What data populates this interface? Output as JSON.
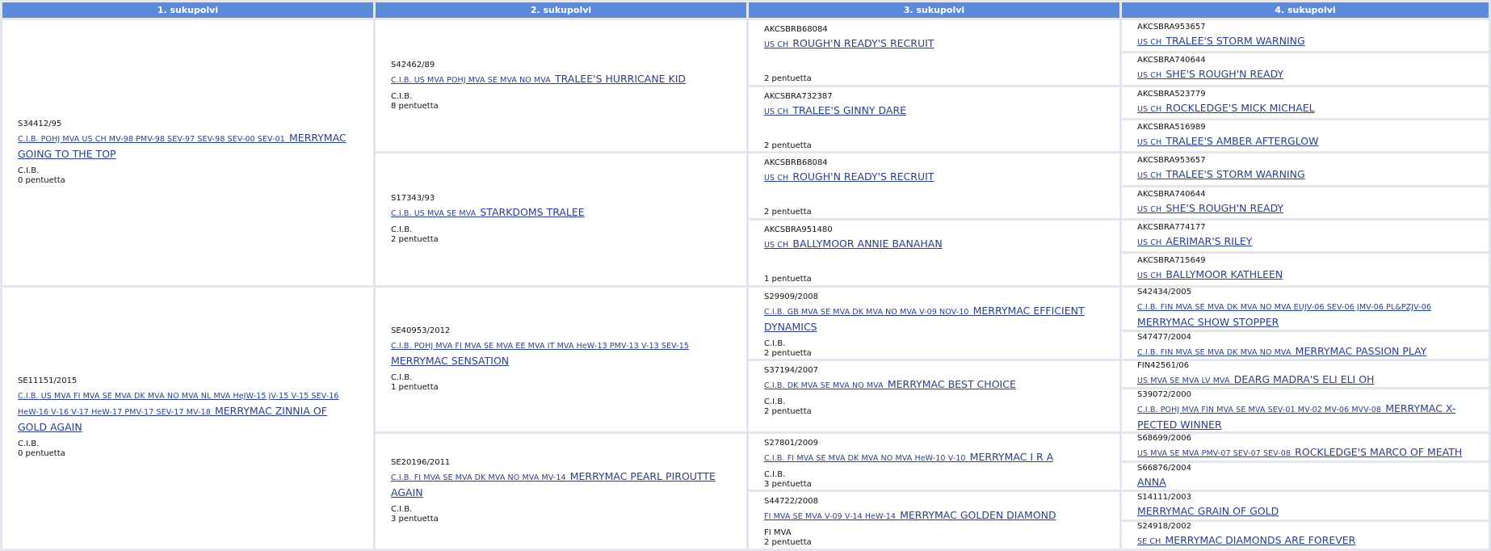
{
  "headers": [
    "1. sukupolvi",
    "2. sukupolvi",
    "3. sukupolvi",
    "4. sukupolvi"
  ],
  "gen1": [
    {
      "reg": "S34412/95",
      "titles": "C.I.B. POHJ MVA US CH MV-98 PMV-98 SEV-97 SEV-98 SEV-00 SEV-01",
      "name": "MERRYMAC GOING TO THE TOP",
      "l1": "C.I.B.",
      "l2": "0 pentuetta"
    },
    {
      "reg": "SE11151/2015",
      "titles": "C.I.B. US MVA FI MVA SE MVA DK MVA NO MVA NL MVA HeJW-15 JV-15 V-15 SEV-16 HeW-16 V-16 V-17 HeW-17 PMV-17 SEV-17 MV-18",
      "name": "MERRYMAC ZINNIA OF GOLD AGAIN",
      "l1": "C.I.B.",
      "l2": "0 pentuetta"
    }
  ],
  "gen2": [
    {
      "reg": "S42462/89",
      "titles": "C.I.B. US MVA POHJ MVA SE MVA NO MVA",
      "name": "TRALEE'S HURRICANE KID",
      "l1": "C.I.B.",
      "l2": "8 pentuetta"
    },
    {
      "reg": "S17343/93",
      "titles": "C.I.B. US MVA SE MVA",
      "name": "STARKDOMS TRALEE",
      "l1": "C.I.B.",
      "l2": "2 pentuetta"
    },
    {
      "reg": "SE40953/2012",
      "titles": "C.I.B. POHJ MVA FI MVA SE MVA EE MVA IT MVA HeW-13 PMV-13 V-13 SEV-15",
      "name": "MERRYMAC SENSATION",
      "l1": "C.I.B.",
      "l2": "1 pentuetta"
    },
    {
      "reg": "SE20196/2011",
      "titles": "C.I.B. FI MVA SE MVA DK MVA NO MVA MV-14",
      "name": "MERRYMAC PEARL PIROUTTE AGAIN",
      "l1": "C.I.B.",
      "l2": "3 pentuetta"
    }
  ],
  "gen3": [
    {
      "reg": "AKCSBRB68084",
      "titles": "US CH",
      "name": "ROUGH'N READY'S RECRUIT",
      "l1": "",
      "l2": "2 pentuetta"
    },
    {
      "reg": "AKCSBRA732387",
      "titles": "US CH",
      "name": "TRALEE'S GINNY DARE",
      "l1": "",
      "l2": "2 pentuetta"
    },
    {
      "reg": "AKCSBRB68084",
      "titles": "US CH",
      "name": "ROUGH'N READY'S RECRUIT",
      "l1": "",
      "l2": "2 pentuetta"
    },
    {
      "reg": "AKCSBRA951480",
      "titles": "US CH",
      "name": "BALLYMOOR ANNIE BANAHAN",
      "l1": "",
      "l2": "1 pentuetta"
    },
    {
      "reg": "S29909/2008",
      "titles": "C.I.B. GB MVA SE MVA DK MVA NO MVA V-09 NOV-10",
      "name": "MERRYMAC EFFICIENT DYNAMICS",
      "l1": "C.I.B.",
      "l2": "2 pentuetta"
    },
    {
      "reg": "S37194/2007",
      "titles": "C.I.B. DK MVA SE MVA NO MVA",
      "name": "MERRYMAC BEST CHOICE",
      "l1": "C.I.B.",
      "l2": "2 pentuetta"
    },
    {
      "reg": "S27801/2009",
      "titles": "C.I.B. FI MVA SE MVA DK MVA NO MVA HeW-10 V-10",
      "name": "MERRYMAC I R A",
      "l1": "C.I.B.",
      "l2": "3 pentuetta"
    },
    {
      "reg": "S44722/2008",
      "titles": "FI MVA SE MVA V-09 V-14 HeW-14",
      "name": "MERRYMAC GOLDEN DIAMOND",
      "l1": "FI MVA",
      "l2": "2 pentuetta"
    }
  ],
  "gen4": [
    {
      "reg": "AKCSBRA953657",
      "titles": "US CH",
      "name": "TRALEE'S STORM WARNING"
    },
    {
      "reg": "AKCSBRA740644",
      "titles": "US CH",
      "name": "SHE'S ROUGH'N READY"
    },
    {
      "reg": "AKCSBRA523779",
      "titles": "US CH",
      "name": "ROCKLEDGE'S MICK MICHAEL"
    },
    {
      "reg": "AKCSBRA516989",
      "titles": "US CH",
      "name": "TRALEE'S AMBER AFTERGLOW"
    },
    {
      "reg": "AKCSBRA953657",
      "titles": "US CH",
      "name": "TRALEE'S STORM WARNING"
    },
    {
      "reg": "AKCSBRA740644",
      "titles": "US CH",
      "name": "SHE'S ROUGH'N READY"
    },
    {
      "reg": "AKCSBRA774177",
      "titles": "US CH",
      "name": "AERIMAR'S RILEY"
    },
    {
      "reg": "AKCSBRA715649",
      "titles": "US CH",
      "name": "BALLYMOOR KATHLEEN"
    },
    {
      "reg": "S42434/2005",
      "titles": "C.I.B. FIN MVA SE MVA DK MVA NO MVA EUJV-06 SEV-06 JMV-06 PL&PZJV-06",
      "name": "MERRYMAC SHOW STOPPER"
    },
    {
      "reg": "S47477/2004",
      "titles": "C.I.B. FIN MVA SE MVA DK MVA NO MVA",
      "name": "MERRYMAC PASSION PLAY"
    },
    {
      "reg": "FIN42561/06",
      "titles": "US MVA SE MVA LV MVA",
      "name": "DEARG MADRA'S ELI ELI OH"
    },
    {
      "reg": "S39072/2000",
      "titles": "C.I.B. POHJ MVA FIN MVA SE MVA SEV-01 MV-02 MV-06 MVV-08",
      "name": "MERRYMAC X-PECTED WINNER"
    },
    {
      "reg": "S68699/2006",
      "titles": "US MVA SE MVA PMV-07 SEV-07 SEV-08",
      "name": "ROCKLEDGE'S MARCO OF MEATH"
    },
    {
      "reg": "S66876/2004",
      "titles": "",
      "name": "ANNA"
    },
    {
      "reg": "S14111/2003",
      "titles": "",
      "name": "MERRYMAC GRAIN OF GOLD"
    },
    {
      "reg": "S24918/2002",
      "titles": "SE CH",
      "name": "MERRYMAC DIAMONDS ARE FOREVER"
    }
  ]
}
